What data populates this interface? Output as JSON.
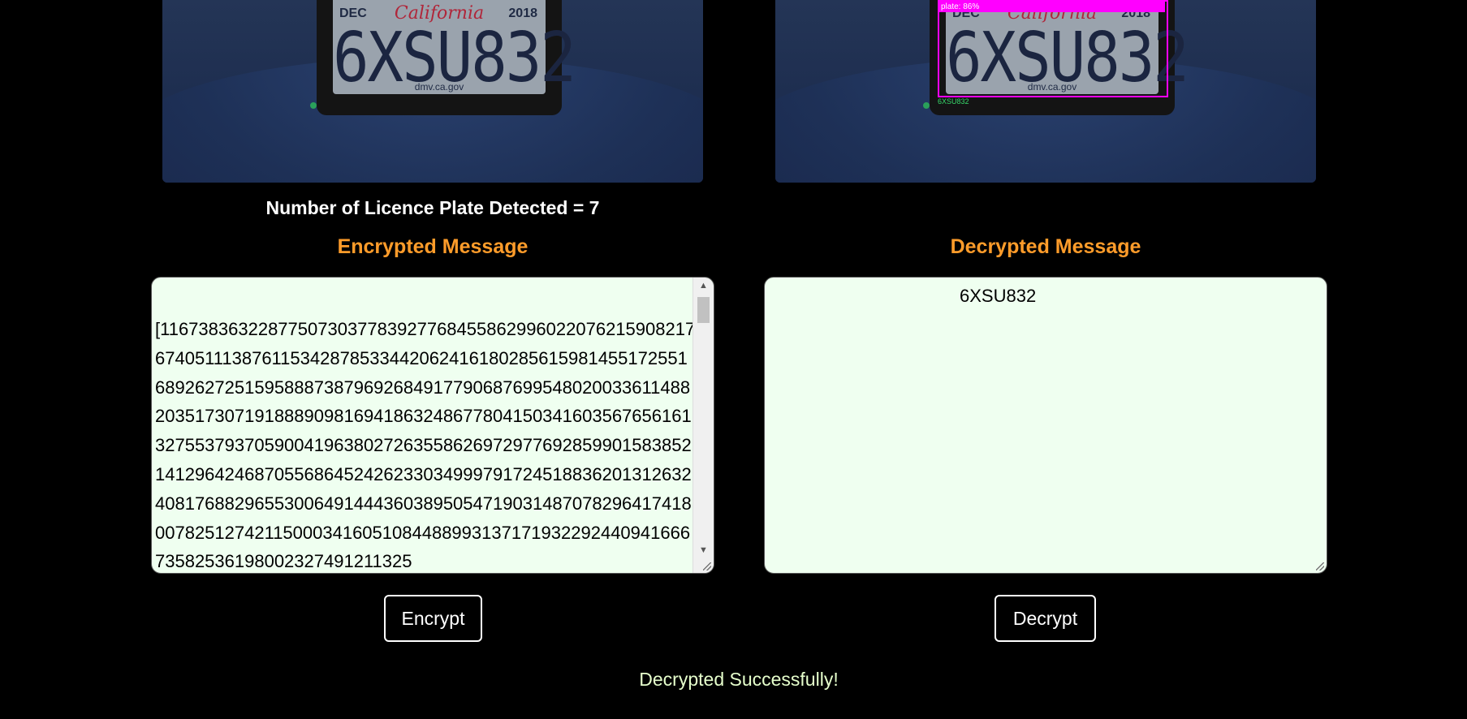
{
  "left_image": {
    "plate_month": "DEC",
    "plate_state": "California",
    "plate_year": "2018",
    "plate_number": "6XSU832",
    "plate_site": "dmv.ca.gov"
  },
  "right_image": {
    "plate_month": "DEC",
    "plate_state": "California",
    "plate_year": "2018",
    "plate_number": "6XSU832",
    "plate_site": "dmv.ca.gov",
    "detection_label": "plate: 86%",
    "ocr_text": "6XSU832"
  },
  "plates_detected_text": "Number of Licence Plate Detected = 7",
  "encrypted": {
    "heading": "Encrypted Message",
    "value": "[1167383632287750730377839277684558629960220762159082176740511138761153428785334420624161802856159814551725516892627251595888738796926849177906876995480200336114882035173071918889098169418632486778041503416035676561613275537937059004196380272635586269729776928599015838521412964246870556864524262330349997917245188362013126324081768829655300649144436038950547190314870782964174180078251274211500034160510844889931371719322924409416667358253619800232749121132​5"
  },
  "decrypted": {
    "heading": "Decrypted Message",
    "value": "6XSU832"
  },
  "buttons": {
    "encrypt": "Encrypt",
    "decrypt": "Decrypt"
  },
  "status_message": "Decrypted Successfully!",
  "colors": {
    "background": "#000000",
    "heading": "#ff9c2a",
    "textbox_bg": "#effff0",
    "detection_box": "#ff00ff",
    "status_text": "#e6ffcc"
  }
}
